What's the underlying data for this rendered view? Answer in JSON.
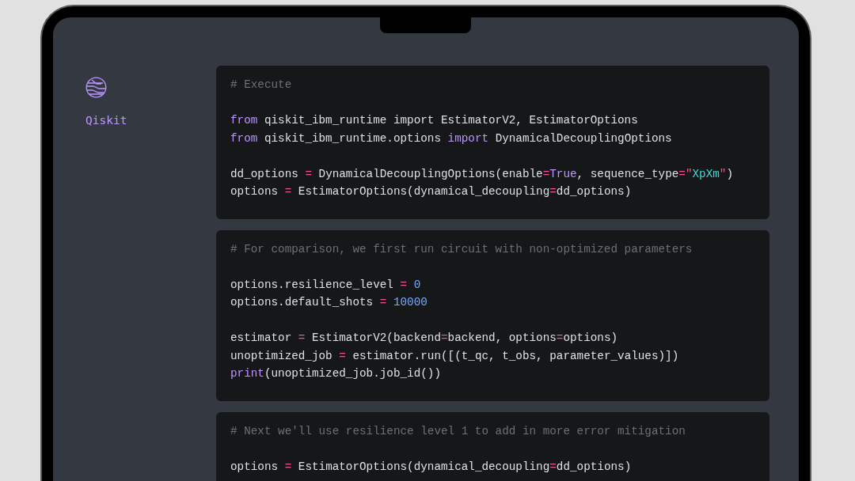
{
  "sidebar": {
    "brand": "Qiskit"
  },
  "cells": [
    {
      "lines": [
        {
          "tokens": [
            {
              "kind": "comment",
              "text": "# Execute"
            }
          ]
        },
        {
          "kind": "blank"
        },
        {
          "tokens": [
            {
              "kind": "keyword",
              "text": "from"
            },
            {
              "kind": "plain",
              "text": " qiskit_ibm_runtime import EstimatorV2, EstimatorOptions"
            }
          ]
        },
        {
          "tokens": [
            {
              "kind": "keyword",
              "text": "from"
            },
            {
              "kind": "plain",
              "text": " qiskit_ibm_runtime.options "
            },
            {
              "kind": "keyword",
              "text": "import"
            },
            {
              "kind": "plain",
              "text": " DynamicalDecouplingOptions"
            }
          ]
        },
        {
          "kind": "blank"
        },
        {
          "tokens": [
            {
              "kind": "plain",
              "text": "dd_options "
            },
            {
              "kind": "operator",
              "text": "="
            },
            {
              "kind": "plain",
              "text": " DynamicalDecouplingOptions(enable"
            },
            {
              "kind": "operator",
              "text": "="
            },
            {
              "kind": "keyword",
              "text": "True"
            },
            {
              "kind": "plain",
              "text": ", sequence_type"
            },
            {
              "kind": "operator",
              "text": "="
            },
            {
              "kind": "operator",
              "text": "\""
            },
            {
              "kind": "string",
              "text": "XpXm"
            },
            {
              "kind": "operator",
              "text": "\""
            },
            {
              "kind": "plain",
              "text": ")"
            }
          ]
        },
        {
          "tokens": [
            {
              "kind": "plain",
              "text": "options "
            },
            {
              "kind": "operator",
              "text": "="
            },
            {
              "kind": "plain",
              "text": " EstimatorOptions(dynamical_decoupling"
            },
            {
              "kind": "operator",
              "text": "="
            },
            {
              "kind": "plain",
              "text": "dd_options)"
            }
          ]
        }
      ]
    },
    {
      "lines": [
        {
          "tokens": [
            {
              "kind": "comment",
              "text": "# For comparison, we first run circuit with non-optimized parameters"
            }
          ]
        },
        {
          "kind": "blank"
        },
        {
          "tokens": [
            {
              "kind": "plain",
              "text": "options.resilience_level "
            },
            {
              "kind": "operator",
              "text": "="
            },
            {
              "kind": "number",
              "text": " 0"
            }
          ]
        },
        {
          "tokens": [
            {
              "kind": "plain",
              "text": "options.default_shots "
            },
            {
              "kind": "operator",
              "text": "="
            },
            {
              "kind": "number",
              "text": " 10000"
            }
          ]
        },
        {
          "kind": "blank"
        },
        {
          "tokens": [
            {
              "kind": "plain",
              "text": "estimator "
            },
            {
              "kind": "operator",
              "text": "="
            },
            {
              "kind": "plain",
              "text": " EstimatorV2(backend"
            },
            {
              "kind": "operator",
              "text": "="
            },
            {
              "kind": "plain",
              "text": "backend, options"
            },
            {
              "kind": "operator",
              "text": "="
            },
            {
              "kind": "plain",
              "text": "options)"
            }
          ]
        },
        {
          "tokens": [
            {
              "kind": "plain",
              "text": "unoptimized_job "
            },
            {
              "kind": "operator",
              "text": "="
            },
            {
              "kind": "plain",
              "text": " estimator.run([(t_qc, t_obs, parameter_values)])"
            }
          ]
        },
        {
          "tokens": [
            {
              "kind": "keyword",
              "text": "print"
            },
            {
              "kind": "plain",
              "text": "(unoptimized_job.job_id())"
            }
          ]
        }
      ]
    },
    {
      "lines": [
        {
          "tokens": [
            {
              "kind": "comment",
              "text": "# Next we'll use resilience level 1 to add in more error mitigation"
            }
          ]
        },
        {
          "kind": "blank"
        },
        {
          "tokens": [
            {
              "kind": "plain",
              "text": "options "
            },
            {
              "kind": "operator",
              "text": "="
            },
            {
              "kind": "plain",
              "text": " EstimatorOptions(dynamical_decoupling"
            },
            {
              "kind": "operator",
              "text": "="
            },
            {
              "kind": "plain",
              "text": "dd_options)"
            }
          ]
        }
      ]
    }
  ]
}
